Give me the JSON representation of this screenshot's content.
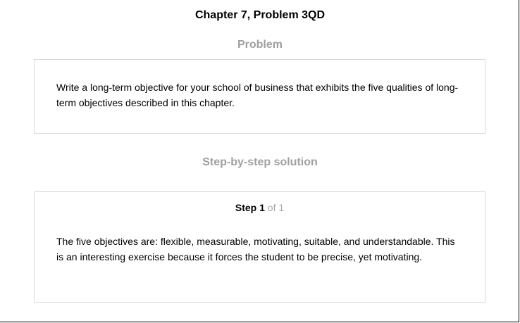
{
  "page_title": "Chapter 7, Problem 3QD",
  "problem": {
    "heading": "Problem",
    "text": "Write a long-term objective for your school of business that exhibits the five qualities of long-term objectives described in this chapter."
  },
  "solution": {
    "heading": "Step-by-step solution",
    "step_word": "Step",
    "step_number": "1",
    "step_of": "of 1",
    "text": "The five objectives are: flexible, measurable, motivating, suitable, and understandable. This is an interesting exercise because it forces the student to be precise, yet motivating."
  }
}
